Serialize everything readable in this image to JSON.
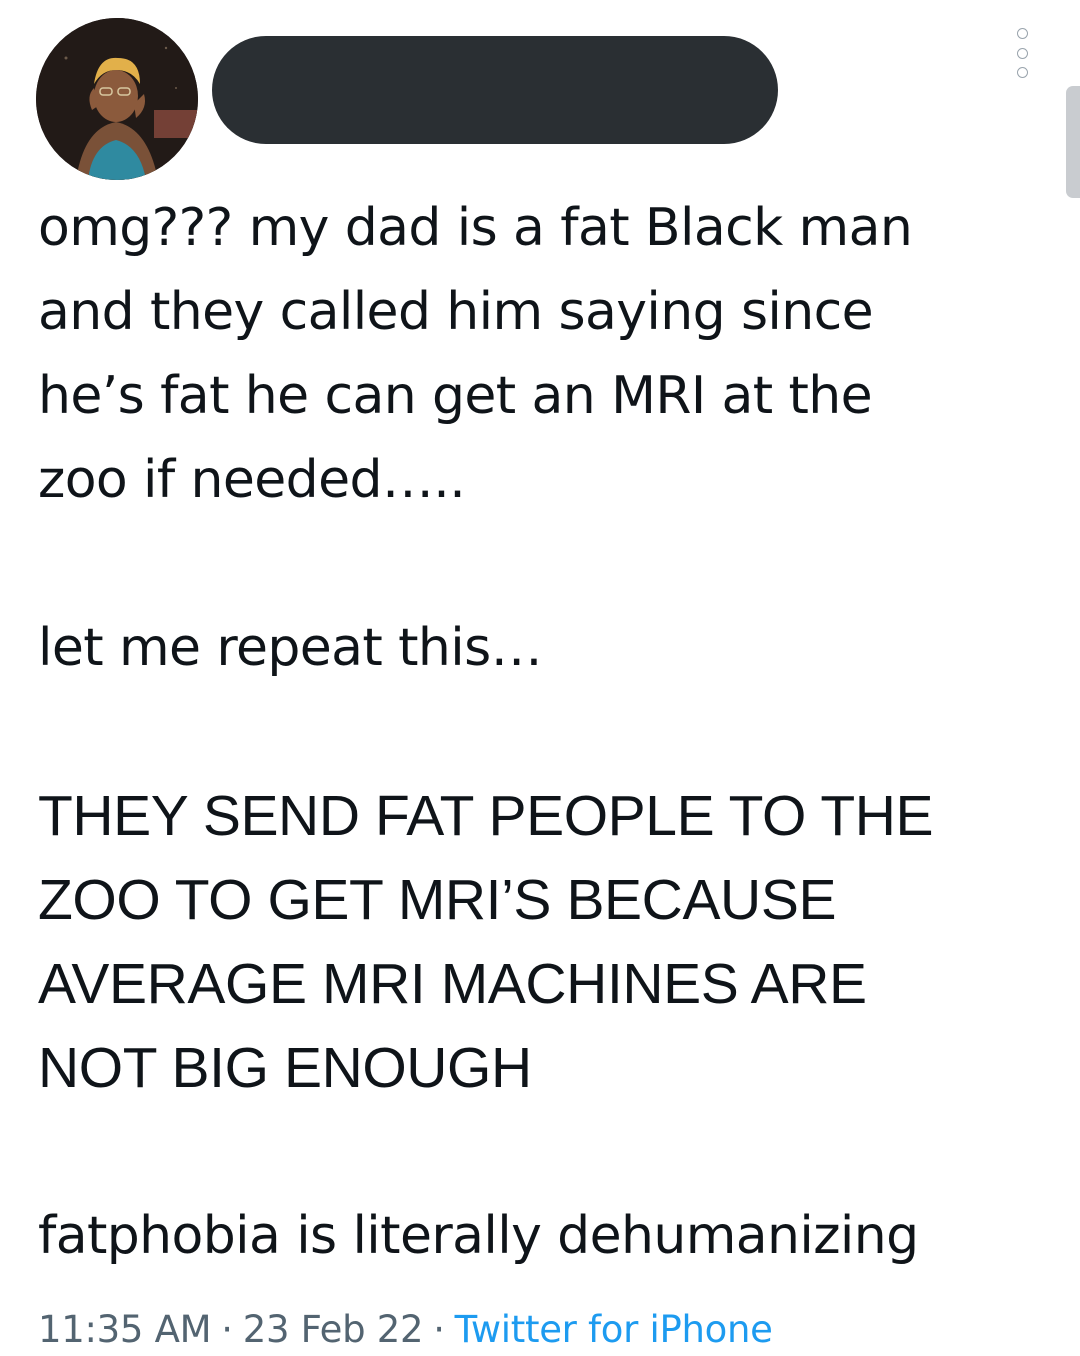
{
  "tweet": {
    "text": {
      "line1": "omg??? my dad is a fat Black man\nand they called him saying since\nhe’s fat he can get an MRI at the\nzoo if needed…..",
      "line2": "let me repeat this…",
      "line3": "THEY SEND FAT PEOPLE TO THE\nZOO TO GET MRI’S BECAUSE\nAVERAGE MRI MACHINES ARE\nNOT BIG ENOUGH",
      "line4": "fatphobia is literally dehumanizing"
    },
    "time": "11:35 AM",
    "separator": "·",
    "date": "23 Feb 22",
    "source": "Twitter for iPhone"
  },
  "icons": {
    "avatar": "profile-photo",
    "more": "more-options-vertical-dots"
  },
  "colors": {
    "text": "#0f1419",
    "meta": "#536471",
    "link": "#1d9bf0",
    "redaction": "#2a2f33"
  }
}
